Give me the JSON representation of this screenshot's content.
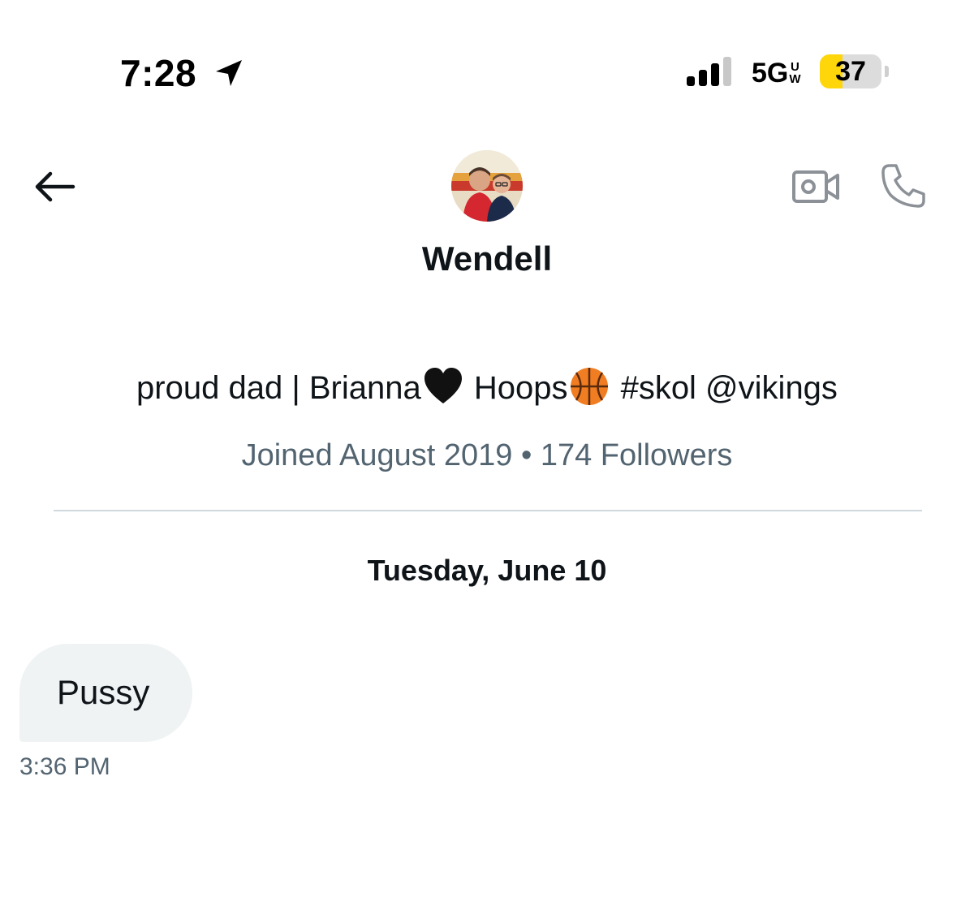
{
  "status_bar": {
    "time": "7:28",
    "network": "5G",
    "network_sub_top": "U",
    "network_sub_bottom": "W",
    "battery_level": "37",
    "battery_fraction": 0.37,
    "battery_color": "#ffd60a",
    "icons": [
      "location-arrow-icon",
      "signal-bars-icon",
      "battery-icon"
    ]
  },
  "header": {
    "name": "Wendell",
    "icons": [
      "back-arrow-icon",
      "video-camera-icon",
      "phone-icon"
    ]
  },
  "profile": {
    "bio_part1": "proud dad | Brianna",
    "bio_part2": " Hoops",
    "bio_part3": " #skol @vikings",
    "bio_emojis": [
      "black-heart-emoji",
      "basketball-emoji"
    ],
    "joined": "Joined August 2019 • 174 Followers"
  },
  "conversation": {
    "date_header": "Tuesday, June 10",
    "messages": [
      {
        "text": "Pussy",
        "time": "3:36 PM",
        "direction": "incoming"
      }
    ]
  },
  "colors": {
    "primary_text": "#0f1419",
    "secondary_text": "#536471",
    "bubble_bg": "#eff3f4",
    "divider": "#cfd9de",
    "icon_gray": "#8b9197"
  }
}
